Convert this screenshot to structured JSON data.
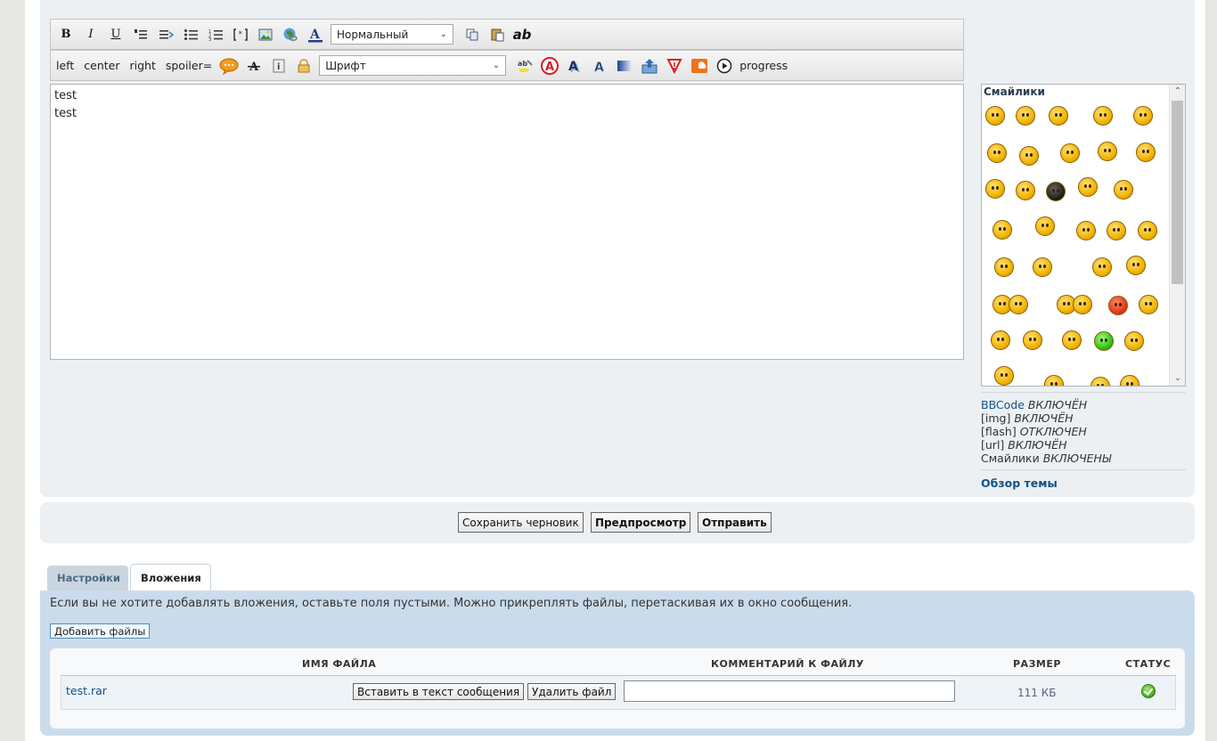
{
  "toolbar1": {
    "buttons": [
      "B",
      "I",
      "U"
    ],
    "format_select": "Нормальный",
    "ab_label": "ab"
  },
  "toolbar2": {
    "text_buttons": [
      "left",
      "center",
      "right",
      "spoiler="
    ],
    "font_select": "Шрифт",
    "progress_label": "progress"
  },
  "editor": {
    "content": "test\ntest"
  },
  "smileys": {
    "title": "Смайлики"
  },
  "status": {
    "bbcode_label": "BBCode",
    "bbcode_val": "ВКЛЮЧЁН",
    "img_label": "[img]",
    "img_val": "ВКЛЮЧЁН",
    "flash_label": "[flash]",
    "flash_val": "ОТКЛЮЧЕН",
    "url_label": "[url]",
    "url_val": "ВКЛЮЧЁН",
    "smilies_label": "Смайлики",
    "smilies_val": "ВКЛЮЧЕНЫ",
    "overview": "Обзор темы"
  },
  "buttons": {
    "save_draft": "Сохранить черновик",
    "preview": "Предпросмотр",
    "submit": "Отправить"
  },
  "tabs": {
    "settings": "Настройки",
    "attachments": "Вложения"
  },
  "attachments": {
    "note": "Если вы не хотите добавлять вложения, оставьте поля пустыми. Можно прикреплять файлы, перетаскивая их в окно сообщения.",
    "add_files": "Добавить файлы",
    "headers": {
      "filename": "ИМЯ ФАЙЛА",
      "comment": "КОММЕНТАРИЙ К ФАЙЛУ",
      "size": "РАЗМЕР",
      "status": "СТАТУС"
    },
    "file": {
      "name": "test.rar",
      "insert": "Вставить в текст сообщения",
      "delete": "Удалить файл",
      "size": "111 КБ"
    }
  },
  "colors": {
    "link": "#105289",
    "panel": "#ecf0f3",
    "attach_panel": "#cadceb"
  }
}
